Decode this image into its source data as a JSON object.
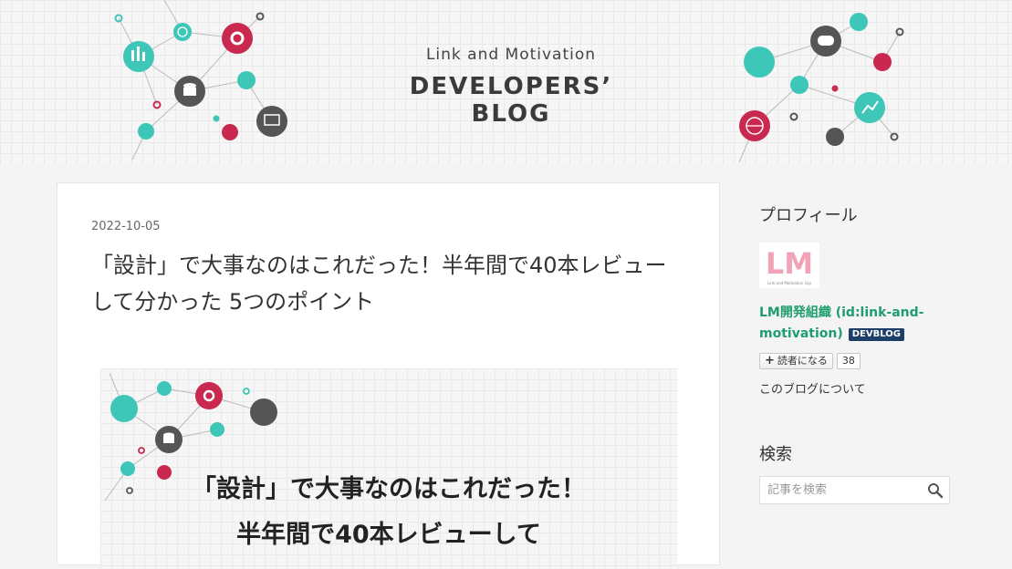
{
  "header": {
    "subtitle": "Link and Motivation",
    "title": "DEVELOPERS’ BLOG"
  },
  "article": {
    "date": "2022-10-05",
    "title": "「設計」で大事なのはこれだった！半年間で40本レビューして分かった 5つのポイント",
    "eyecatch_line_1": "「設計」で大事なのはこれだった！",
    "eyecatch_line_2": "半年間で40本レビューして"
  },
  "sidebar": {
    "profile": {
      "section_title": "プロフィール",
      "logo_text": "LM",
      "logo_caption": "Link and Motivation Grp",
      "name": "LM開発組織 (id:link-and-motivation)",
      "badge": "DEVBLOG",
      "subscribe_label": "読者になる",
      "subscriber_count": "38",
      "about_link": "このブログについて"
    },
    "search": {
      "section_title": "検索",
      "placeholder": "記事を検索"
    }
  },
  "colors": {
    "teal": "#3ec6b8",
    "crimson": "#c9284f",
    "dark_gray": "#555555",
    "link_green": "#1f9d6f",
    "badge_navy": "#1b3f66"
  },
  "icons": {
    "search": "search-icon",
    "plus": "plus-icon"
  }
}
